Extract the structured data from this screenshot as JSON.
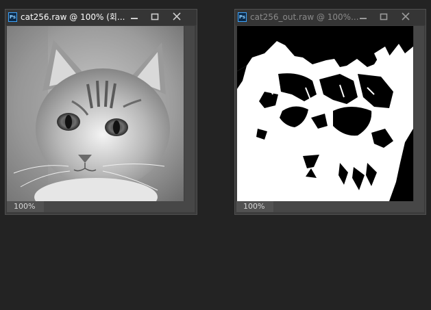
{
  "windows": [
    {
      "title": "cat256.raw @ 100% (회...",
      "zoom": "100%",
      "icon": "photoshop-app-icon",
      "active": true
    },
    {
      "title": "cat256_out.raw @ 100%...",
      "zoom": "100%",
      "icon": "photoshop-app-icon",
      "active": false
    }
  ],
  "colors": {
    "workspace": "#232323",
    "title_active": "#ffffff",
    "title_inactive": "#8a8a8a",
    "window_frame": "#3c3c3c"
  }
}
